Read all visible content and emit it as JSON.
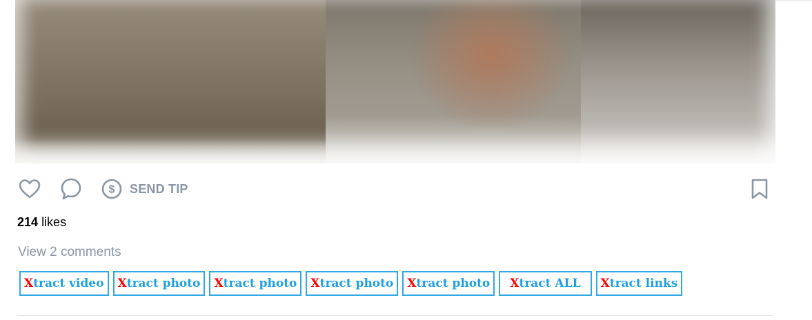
{
  "post": {
    "media_alt": "blurred image",
    "actions": {
      "like_icon": "heart-icon",
      "comment_icon": "comment-bubble-icon",
      "tip_icon": "dollar-circle-icon",
      "tip_label": "SEND TIP",
      "bookmark_icon": "bookmark-icon"
    },
    "likes": {
      "count": "214",
      "label": "likes"
    },
    "comments_link": "View 2 comments"
  },
  "xtract": {
    "prefix": "X",
    "buttons": [
      {
        "rest": "tract video"
      },
      {
        "rest": "tract photo"
      },
      {
        "rest": "tract photo"
      },
      {
        "rest": "tract photo"
      },
      {
        "rest": "tract photo"
      },
      {
        "rest": "tract ALL"
      },
      {
        "rest": "tract links"
      }
    ]
  },
  "colors": {
    "icon": "#8a96a3",
    "xtract_border": "#2fa8e4",
    "xtract_text": "#1ea0e2",
    "xtract_prefix": "#ff0000"
  }
}
